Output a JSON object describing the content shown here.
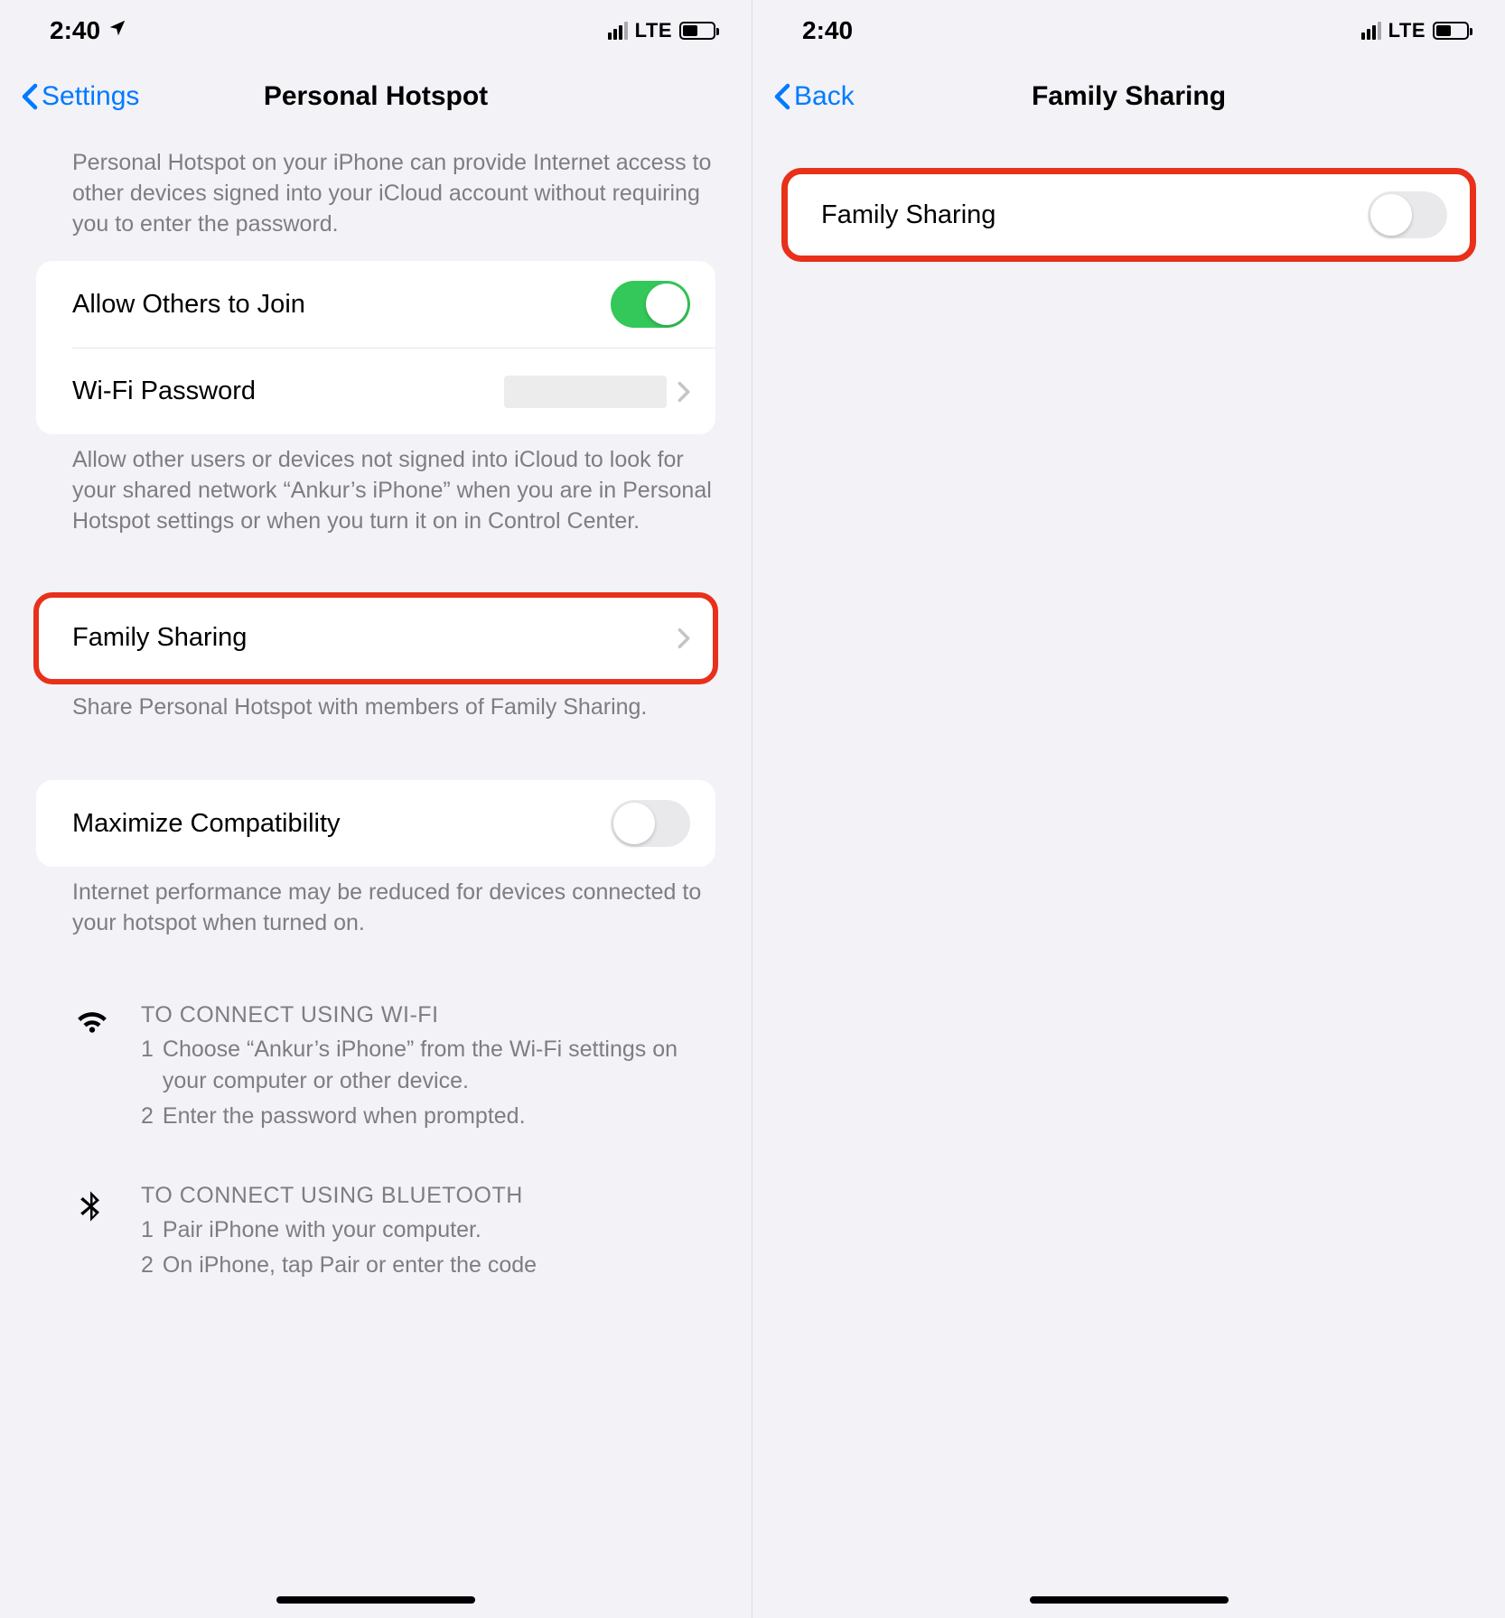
{
  "status": {
    "time": "2:40",
    "network": "LTE"
  },
  "left": {
    "back_label": "Settings",
    "title": "Personal Hotspot",
    "intro": "Personal Hotspot on your iPhone can provide Internet access to other devices signed into your iCloud account without requiring you to enter the password.",
    "allow_others_label": "Allow Others to Join",
    "allow_others_on": true,
    "wifi_password_label": "Wi-Fi Password",
    "allow_desc": "Allow other users or devices not signed into iCloud to look for your shared network “Ankur’s iPhone” when you are in Personal Hotspot settings or when you turn it on in Control Center.",
    "family_sharing_label": "Family Sharing",
    "family_desc": "Share Personal Hotspot with members of Family Sharing.",
    "maximize_label": "Maximize Compatibility",
    "maximize_on": false,
    "maximize_desc": "Internet performance may be reduced for devices connected to your hotspot when turned on.",
    "wifi_heading": "TO CONNECT USING WI-FI",
    "wifi_step1": "Choose “Ankur’s iPhone” from the Wi-Fi settings on your computer or other device.",
    "wifi_step2": "Enter the password when prompted.",
    "bt_heading": "TO CONNECT USING BLUETOOTH",
    "bt_step1": "Pair iPhone with your computer.",
    "bt_step2": "On iPhone, tap Pair or enter the code"
  },
  "right": {
    "back_label": "Back",
    "title": "Family Sharing",
    "family_sharing_label": "Family Sharing",
    "family_sharing_on": false
  }
}
